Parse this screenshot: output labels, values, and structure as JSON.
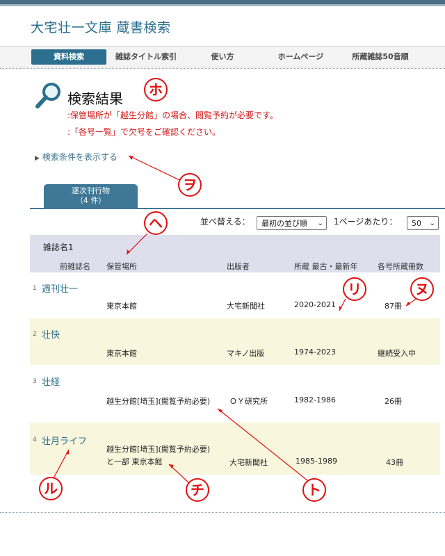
{
  "site": {
    "title": "大宅壮一文庫 蔵書検索"
  },
  "nav": {
    "items": [
      {
        "label": "資料検索",
        "active": true
      },
      {
        "label": "雑誌タイトル索引",
        "active": false
      },
      {
        "label": "使い方",
        "active": false
      },
      {
        "label": "ホームページ",
        "active": false
      },
      {
        "label": "所蔵雑誌50音順",
        "active": false
      }
    ]
  },
  "results": {
    "title": "検索結果",
    "notices": [
      ":保管場所が「越生分館」の場合、閲覧予約が必要です。",
      ":「各号一覧」で欠号をご確認ください。"
    ],
    "show_conditions": "検索条件を表示する"
  },
  "tab": {
    "line1": "逐次刊行物",
    "line2": "（4 件）"
  },
  "sort": {
    "label": "並べ替える：",
    "selected": "最初の並び順",
    "per_page_label": "1ページあたり：",
    "per_page": "50"
  },
  "table": {
    "header_top": "雑誌名1",
    "columns": [
      "前雑誌名",
      "保管場所",
      "出版者",
      "所蔵 最古・最新年",
      "各号所蔵冊数"
    ],
    "rows": [
      {
        "num": "1",
        "title": "週刊壮一",
        "location1": "東京本館",
        "location2": "",
        "publisher": "大宅新聞社",
        "years": "2020-2021",
        "count": "87冊"
      },
      {
        "num": "2",
        "title": "壮快",
        "location1": "東京本館",
        "location2": "",
        "publisher": "マキノ出版",
        "years": "1974-2023",
        "count": "継続受入中"
      },
      {
        "num": "3",
        "title": "壮経",
        "location1": "越生分館[埼玉](閲覧予約必要)",
        "location2": "",
        "publisher": "ＯＹ研究所",
        "years": "1982-1986",
        "count": "26冊"
      },
      {
        "num": "4",
        "title": "壮月ライフ",
        "location1": "越生分館[埼玉](閲覧予約必要)",
        "location2": "と一部 東京本館",
        "publisher": "大宅新聞社",
        "years": "1985-1989",
        "count": "43冊"
      }
    ]
  },
  "annotations": [
    "ホ",
    "ヲ",
    "ヘ",
    "リ",
    "ヌ",
    "ト",
    "チ",
    "ル"
  ],
  "colors": {
    "accent": "#2d6f8f",
    "notice": "#d01818",
    "annotation": "#e01010",
    "row_alt": "#f8f6dc",
    "header_bg": "#dedeed"
  },
  "icons": {
    "search": "magnifier-icon",
    "toggle": "triangle-right-icon",
    "dropdown": "chevron-down-icon"
  }
}
